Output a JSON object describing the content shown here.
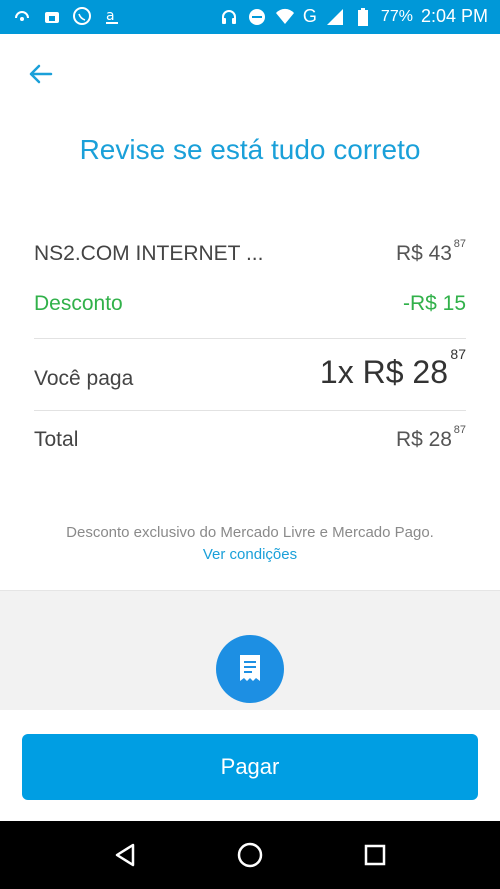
{
  "status_bar": {
    "battery_percent": "77%",
    "time": "2:04 PM",
    "network_label": "G"
  },
  "page": {
    "title": "Revise se está tudo correto"
  },
  "summary": {
    "product_name": "NS2.COM INTERNET ...",
    "product_price_main": "R$ 43",
    "product_price_cents": "87",
    "discount_label": "Desconto",
    "discount_value": "-R$ 15",
    "you_pay_label": "Você paga",
    "you_pay_main": "1x R$ 28",
    "you_pay_cents": "87",
    "total_label": "Total",
    "total_main": "R$ 28",
    "total_cents": "87"
  },
  "notes": {
    "discount_note": "Desconto exclusivo do Mercado Livre e Mercado Pago.",
    "conditions_link": "Ver condições"
  },
  "actions": {
    "pay_label": "Pagar"
  },
  "colors": {
    "status_bar": "#0098d8",
    "accent": "#1aa0d9",
    "discount": "#31b14a",
    "button": "#009ee3",
    "receipt_icon_bg": "#1d8fe3"
  }
}
